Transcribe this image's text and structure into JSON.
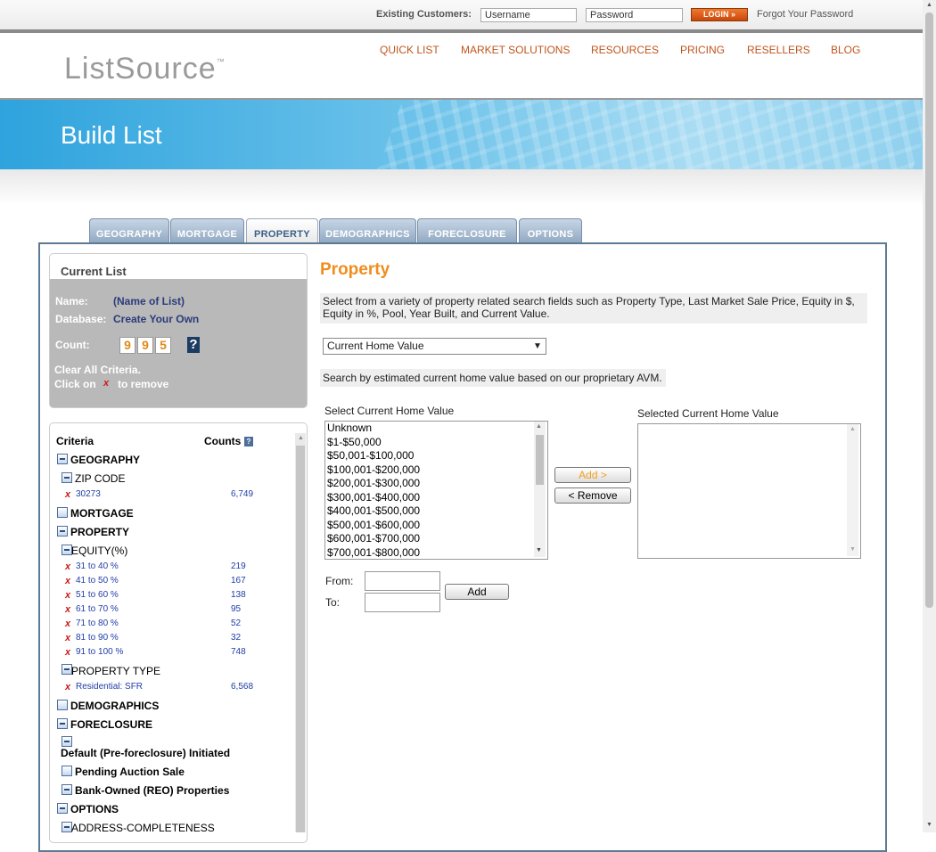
{
  "topbar": {
    "existing_label": "Existing Customers:",
    "username_placeholder": "Username",
    "password_placeholder": "Password",
    "login_label": "LOGIN »",
    "forgot_label": "Forgot Your Password"
  },
  "header": {
    "logo": "ListSource",
    "logo_tm": "™",
    "nav": [
      "QUICK LIST",
      "MARKET SOLUTIONS",
      "RESOURCES",
      "PRICING",
      "RESELLERS",
      "BLOG"
    ]
  },
  "banner": {
    "title": "Build List"
  },
  "tabs": [
    "GEOGRAPHY",
    "MORTGAGE",
    "PROPERTY",
    "DEMOGRAPHICS",
    "FORECLOSURE",
    "OPTIONS"
  ],
  "active_tab": "PROPERTY",
  "current_list": {
    "title": "Current List",
    "name_label": "Name:",
    "name_value": "(Name of List)",
    "database_label": "Database:",
    "database_value": "Create Your Own",
    "count_label": "Count:",
    "count_digits": [
      "9",
      "9",
      "5"
    ],
    "help": "?",
    "clear_label": "Clear All Criteria.",
    "click_on": "Click on",
    "x_mark": "x",
    "to_remove": "to remove"
  },
  "criteria": {
    "col_criteria": "Criteria",
    "col_counts": "Counts",
    "help": "?",
    "geography": "GEOGRAPHY",
    "zip_code": "ZIP CODE",
    "zip_item": "30273",
    "zip_count": "6,749",
    "mortgage": "MORTGAGE",
    "property": "PROPERTY",
    "equity": "EQUITY(%)",
    "equity_items": [
      {
        "label": "31 to 40 %",
        "count": "219"
      },
      {
        "label": "41 to 50 %",
        "count": "167"
      },
      {
        "label": "51 to 60 %",
        "count": "138"
      },
      {
        "label": "61 to 70 %",
        "count": "95"
      },
      {
        "label": "71 to 80 %",
        "count": "52"
      },
      {
        "label": "81 to 90 %",
        "count": "32"
      },
      {
        "label": "91 to 100 %",
        "count": "748"
      }
    ],
    "property_type": "PROPERTY TYPE",
    "ptype_item": "Residential: SFR",
    "ptype_count": "6,568",
    "demographics": "DEMOGRAPHICS",
    "foreclosure": "FORECLOSURE",
    "default_pre": "Default (Pre-foreclosure) Initiated",
    "pending_auction": "Pending Auction Sale",
    "bank_owned": "Bank-Owned (REO) Properties",
    "options": "OPTIONS",
    "address_completeness": "ADDRESS-COMPLETENESS"
  },
  "property": {
    "title": "Property",
    "description": "Select from a variety of property related search fields such as Property Type, Last Market Sale Price, Equity in $, Equity in %, Pool, Year Built, and Current Value.",
    "field_select": "Current Home Value",
    "field_description": "Search by estimated current home value based on our proprietary AVM.",
    "select_label": "Select Current Home Value",
    "selected_label": "Selected Current Home Value",
    "options": [
      "Unknown",
      "$1-$50,000",
      "$50,001-$100,000",
      "$100,001-$200,000",
      "$200,001-$300,000",
      "$300,001-$400,000",
      "$400,001-$500,000",
      "$500,001-$600,000",
      "$600,001-$700,000",
      "$700,001-$800,000"
    ],
    "add_button": "Add >",
    "remove_button": "< Remove",
    "from_label": "From:",
    "to_label": "To:",
    "add_range_button": "Add"
  }
}
